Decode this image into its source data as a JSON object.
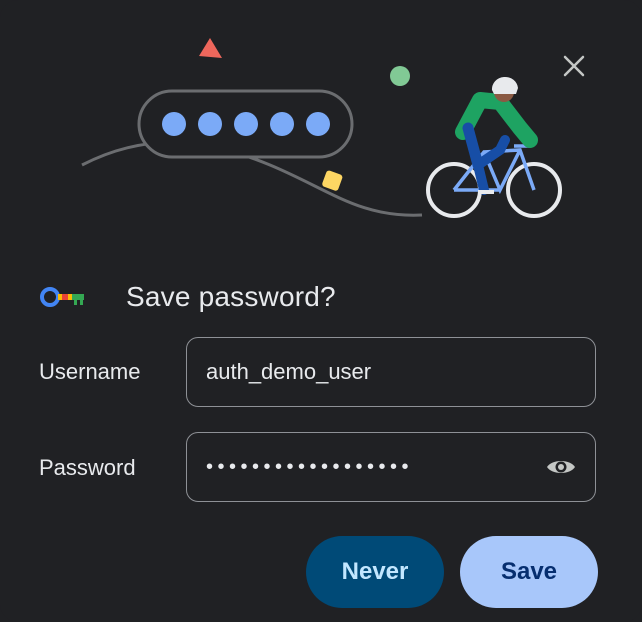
{
  "dialog": {
    "title": "Save password?",
    "close_icon": "close-icon",
    "illustration": "password-dots-cyclist-illustration"
  },
  "form": {
    "username_label": "Username",
    "username_value": "auth_demo_user",
    "password_label": "Password",
    "password_masked": "••••••••••••••••••",
    "reveal_icon": "eye-icon"
  },
  "actions": {
    "never_label": "Never",
    "save_label": "Save"
  },
  "colors": {
    "background": "#202124",
    "text": "#e8eaed",
    "never_bg": "#004a77",
    "never_text": "#c2e7ff",
    "save_bg": "#a8c7fa",
    "save_text": "#062e6f",
    "dot_blue": "#7baaf7"
  }
}
